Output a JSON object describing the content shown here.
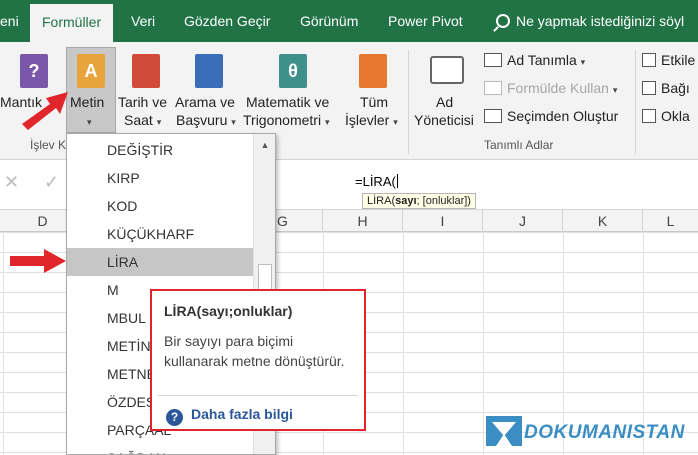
{
  "tabs": [
    {
      "label": "eni",
      "active": false
    },
    {
      "label": "Formüller",
      "active": true
    },
    {
      "label": "Veri",
      "active": false
    },
    {
      "label": "Gözden Geçir",
      "active": false
    },
    {
      "label": "Görünüm",
      "active": false
    },
    {
      "label": "Power Pivot",
      "active": false
    }
  ],
  "tell_me": "Ne yapmak istediğinizi söyl",
  "ribbon": {
    "mantik": "Mantık",
    "metin": "Metin",
    "tarih_line1": "Tarih ve",
    "tarih_line2": "Saat",
    "arama_line1": "Arama ve",
    "arama_line2": "Başvuru",
    "matematik_line1": "Matematik ve",
    "matematik_line2": "Trigonometri",
    "tum_line1": "Tüm",
    "tum_line2": "İşlevler",
    "ad_line1": "Ad",
    "ad_line2": "Yöneticisi",
    "ad_tanimla": "Ad Tanımla",
    "formulde_kullan": "Formülde Kullan",
    "secimden_olustur": "Seçimden Oluştur",
    "etki": "Etkile",
    "bag": "Bağı",
    "okla": "Okla",
    "group_islev": "İşlev K",
    "group_tanimli": "Tanımlı Adlar",
    "caret": "▾",
    "icon_text": {
      "mantik": "?",
      "metin": "A",
      "matematik": "θ"
    }
  },
  "formula_bar": {
    "cancel": "✕",
    "enter": "✓",
    "formula": "=LİRA(",
    "tooltip_fn": "LİRA(",
    "tooltip_bold": "sayı",
    "tooltip_rest": "; [onluklar])"
  },
  "columns": [
    "D",
    "G",
    "H",
    "I",
    "J",
    "K",
    "L"
  ],
  "function_list": [
    "DEĞİŞTİR",
    "KIRP",
    "KOD",
    "KÜÇÜKHARF",
    "LİRA",
    "M",
    "MBUL",
    "METİN",
    "METNE",
    "ÖZDEŞ",
    "PARÇAAL",
    "SAĞDAN"
  ],
  "selected_function": "LİRA",
  "function_tooltip": {
    "title": "LİRA(sayı;onluklar)",
    "description": "Bir sayıyı para biçimi kullanarak metne dönüştürür.",
    "more": "Daha fazla bilgi",
    "help_glyph": "?"
  },
  "watermark": "DOKUMANISTAN",
  "colors": {
    "excel_green": "#217346",
    "highlight_red": "#e0262b",
    "link_blue": "#2b579a",
    "watermark_blue": "#3a8ec4"
  }
}
